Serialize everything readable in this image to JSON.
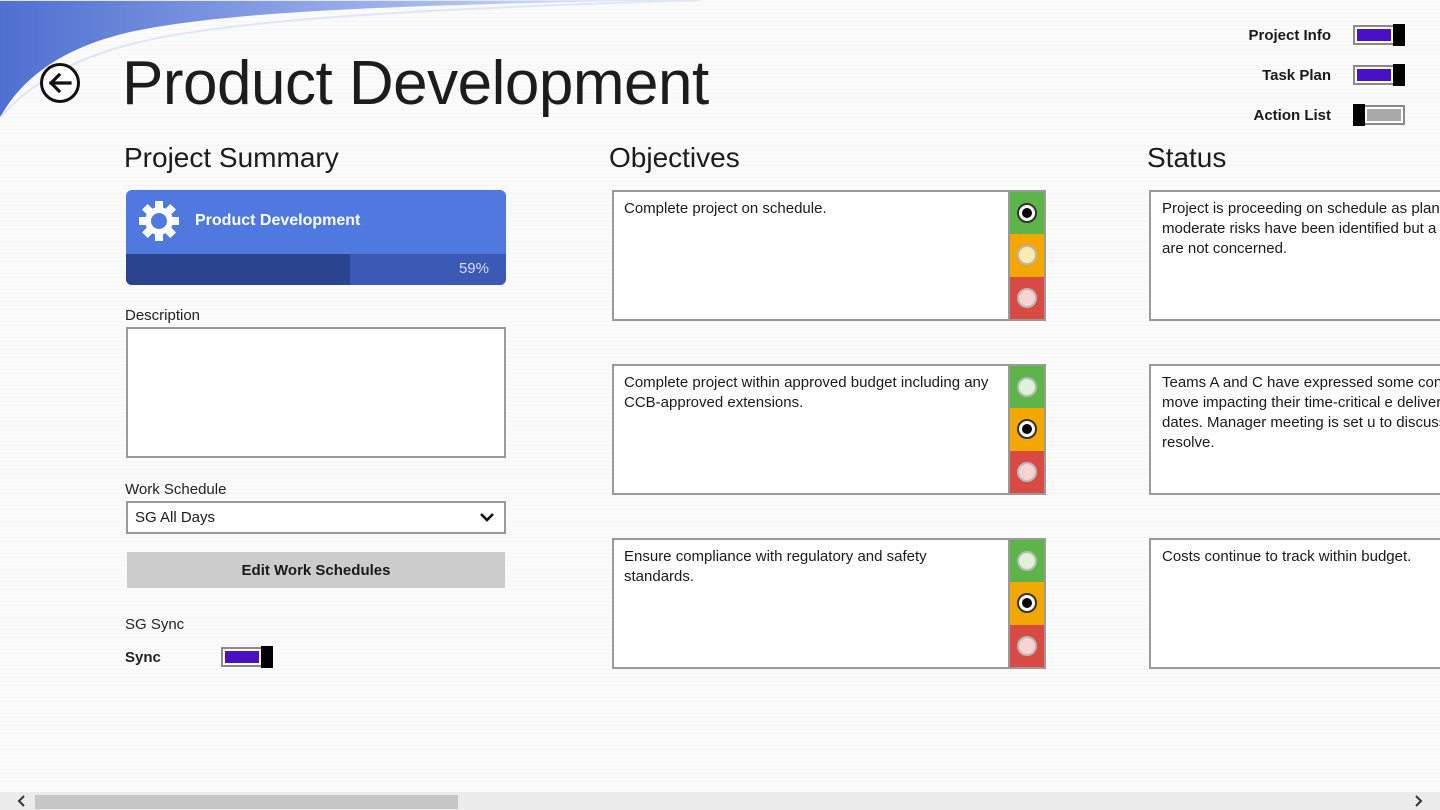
{
  "header": {
    "title": "Product Development"
  },
  "view_toggles": [
    {
      "label": "Project Info",
      "state": "on"
    },
    {
      "label": "Task Plan",
      "state": "on"
    },
    {
      "label": "Action List",
      "state": "off"
    }
  ],
  "project_summary": {
    "heading": "Project Summary",
    "tile": {
      "name": "Product Development",
      "progress_text": "59%",
      "progress": 0.59
    },
    "description_label": "Description",
    "description_value": "",
    "work_schedule_label": "Work Schedule",
    "work_schedule_value": "SG All Days",
    "edit_button": "Edit Work Schedules",
    "sync_section_label": "SG Sync",
    "sync_label": "Sync",
    "sync_state": "on"
  },
  "objectives": {
    "heading": "Objectives",
    "items": [
      {
        "text": "Complete project on schedule.",
        "selected": "green"
      },
      {
        "text": "Complete project within approved budget including any CCB-approved extensions.",
        "selected": "yellow"
      },
      {
        "text": "Ensure compliance with regulatory and safety standards.",
        "selected": "yellow"
      }
    ]
  },
  "status": {
    "heading": "Status",
    "items": [
      "Project is proceeding on schedule as plan moderate risks have been identified but a we are not concerned.",
      "Teams A and C have expressed some con the move impacting their time-critical e delivery dates.  Manager meeting is set u to discuss and resolve.",
      "Costs continue to track within budget."
    ]
  },
  "colors": {
    "accent": "#4a10c4",
    "tile": "#5079e0",
    "light_green": "#5db54a",
    "light_yellow": "#f2a800",
    "light_red": "#d94a44"
  }
}
